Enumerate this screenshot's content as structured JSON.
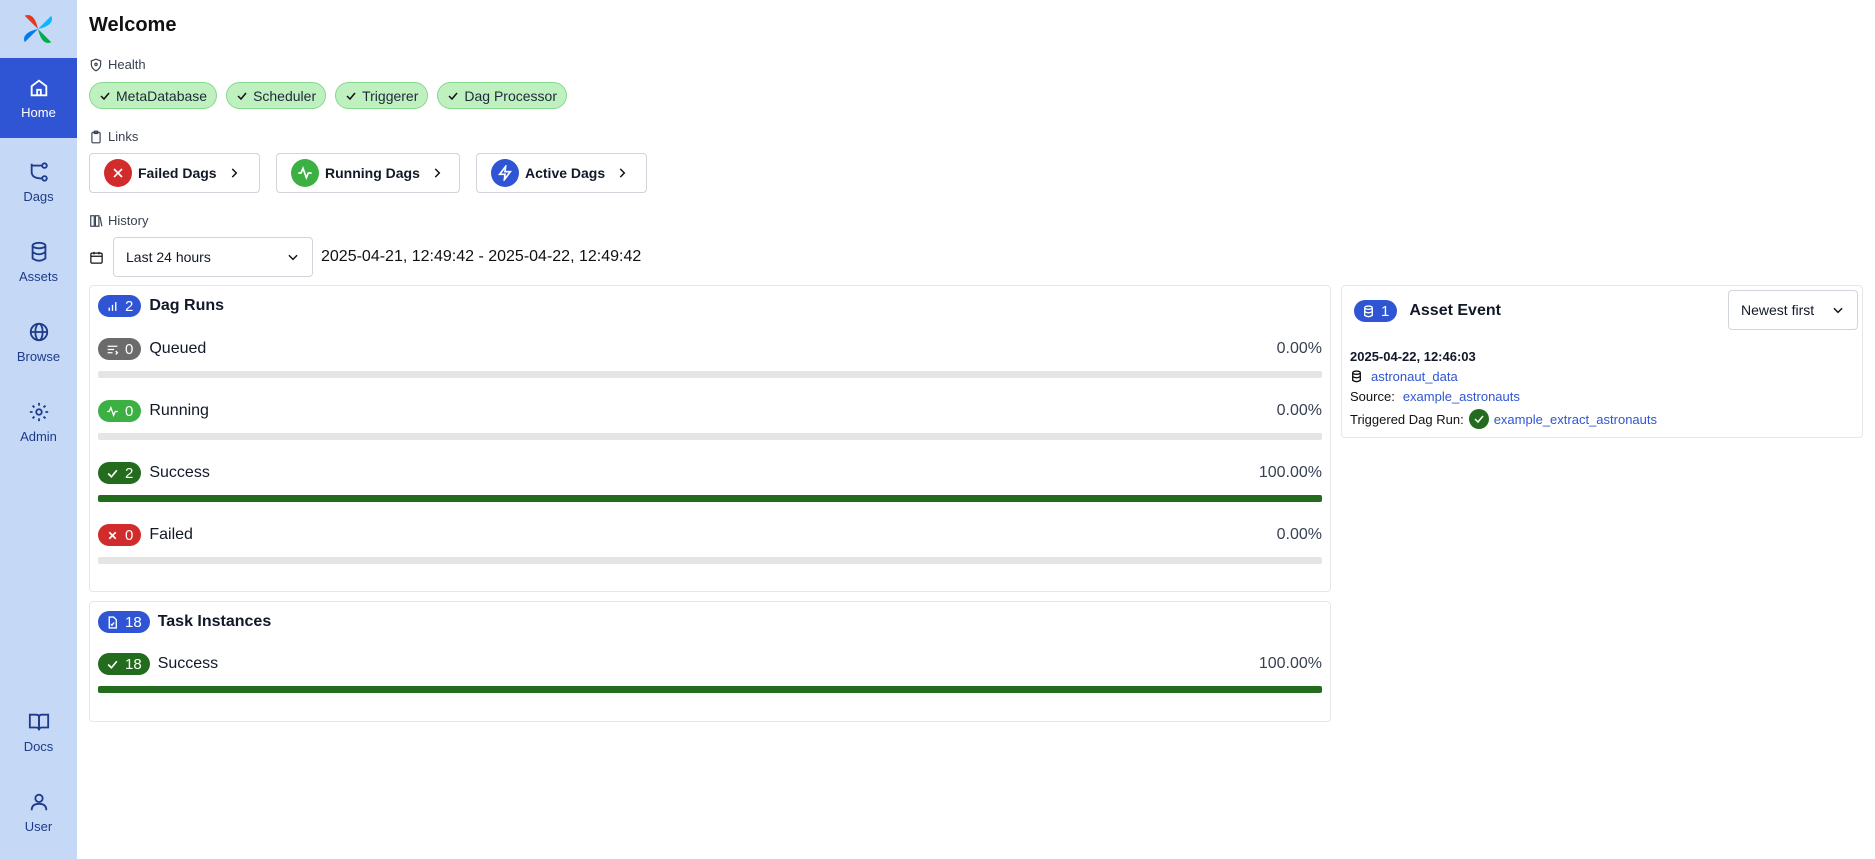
{
  "nav": {
    "items": [
      {
        "label": "Home",
        "icon": "home-icon",
        "active": true
      },
      {
        "label": "Dags",
        "icon": "dags-icon"
      },
      {
        "label": "Assets",
        "icon": "database-icon"
      },
      {
        "label": "Browse",
        "icon": "globe-icon"
      },
      {
        "label": "Admin",
        "icon": "gear-icon"
      }
    ],
    "bottom": [
      {
        "label": "Docs",
        "icon": "book-icon"
      },
      {
        "label": "User",
        "icon": "user-icon"
      }
    ]
  },
  "page": {
    "title": "Welcome"
  },
  "health": {
    "label": "Health",
    "items": [
      "MetaDatabase",
      "Scheduler",
      "Triggerer",
      "Dag Processor"
    ]
  },
  "links": {
    "label": "Links",
    "items": [
      {
        "label": "Failed Dags",
        "color": "#d12b2b"
      },
      {
        "label": "Running Dags",
        "color": "#3cb043"
      },
      {
        "label": "Active Dags",
        "color": "#2f55d4"
      }
    ]
  },
  "history": {
    "label": "History",
    "select_value": "Last 24 hours",
    "range": "2025-04-21, 12:49:42 - 2025-04-22, 12:49:42"
  },
  "dag_runs": {
    "count": "2",
    "title": "Dag Runs",
    "rows": [
      {
        "count": "0",
        "label": "Queued",
        "pct": "0.00%",
        "fraction": 0,
        "color": "#6b6b6b"
      },
      {
        "count": "0",
        "label": "Running",
        "pct": "0.00%",
        "fraction": 0,
        "color": "#3cb043"
      },
      {
        "count": "2",
        "label": "Success",
        "pct": "100.00%",
        "fraction": 1,
        "color": "#236b1d"
      },
      {
        "count": "0",
        "label": "Failed",
        "pct": "0.00%",
        "fraction": 0,
        "color": "#d12b2b"
      }
    ]
  },
  "task_instances": {
    "count": "18",
    "title": "Task Instances",
    "rows": [
      {
        "count": "18",
        "label": "Success",
        "pct": "100.00%",
        "fraction": 1,
        "color": "#236b1d"
      }
    ]
  },
  "asset_events": {
    "count": "1",
    "title": "Asset Event",
    "sort_value": "Newest first",
    "event": {
      "time": "2025-04-22, 12:46:03",
      "asset": "astronaut_data",
      "source_label": "Source:",
      "source": "example_astronauts",
      "triggered_label": "Triggered Dag Run:",
      "triggered": "example_extract_astronauts"
    }
  },
  "colors": {
    "accent": "#2f55d4",
    "sidebar": "#c5d9f7",
    "success": "#236b1d"
  }
}
